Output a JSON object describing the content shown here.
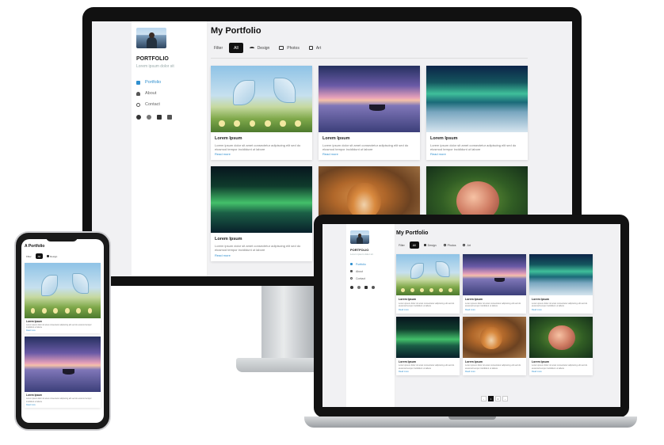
{
  "profile": {
    "name": "PORTFOLIO",
    "tagline": "Lorem ipsum dolor sit",
    "nav": [
      {
        "label": "Portfolio",
        "icon": "grid-icon",
        "active": true
      },
      {
        "label": "About",
        "icon": "user-icon",
        "active": false
      },
      {
        "label": "Contact",
        "icon": "globe-icon",
        "active": false
      }
    ],
    "social": [
      "github-icon",
      "instagram-icon",
      "twitter-icon",
      "linkedin-icon"
    ]
  },
  "main": {
    "title": "My Portfolio",
    "filters": [
      {
        "label": "Filter",
        "icon": "",
        "active": false
      },
      {
        "label": "All",
        "icon": "",
        "active": true
      },
      {
        "label": "Design",
        "icon": "wifi-icon",
        "active": false
      },
      {
        "label": "Photos",
        "icon": "monitor-icon",
        "active": false
      },
      {
        "label": "Art",
        "icon": "box-icon",
        "active": false
      }
    ]
  },
  "cards": [
    {
      "title": "Lorem Ipsum",
      "desc": "Lorem ipsum dolor sit amet consectetur adipiscing elit sed do eiusmod tempor incididunt ut labore",
      "link": "Read more",
      "theme": "img-butterfly"
    },
    {
      "title": "Lorem Ipsum",
      "desc": "Lorem ipsum dolor sit amet consectetur adipiscing elit sed do eiusmod tempor incididunt ut labore",
      "link": "Read more",
      "theme": "img-lake"
    },
    {
      "title": "Lorem Ipsum",
      "desc": "Lorem ipsum dolor sit amet consectetur adipiscing elit sed do eiusmod tempor incididunt ut labore",
      "link": "Read more",
      "theme": "img-aurora"
    },
    {
      "title": "Lorem Ipsum",
      "desc": "Lorem ipsum dolor sit amet consectetur adipiscing elit sed do eiusmod tempor incididunt ut labore",
      "link": "Read more",
      "theme": "img-aurora2"
    },
    {
      "title": "Lorem Ipsum",
      "desc": "Lorem ipsum dolor sit amet consectetur adipiscing elit sed do eiusmod tempor incididunt ut labore",
      "link": "Read more",
      "theme": "img-fox"
    },
    {
      "title": "Lorem Ipsum",
      "desc": "Lorem ipsum dolor sit amet consectetur adipiscing elit sed do eiusmod tempor incididunt ut labore",
      "link": "Read more",
      "theme": "img-fish"
    }
  ],
  "pagination": {
    "pages": [
      "‹",
      "1",
      "2",
      "›"
    ],
    "active": "1"
  },
  "phone": {
    "title": "A Portfolio"
  },
  "colors": {
    "accent": "#2f8fcf",
    "active_filter": "#111111",
    "background": "#f1f1f3"
  }
}
